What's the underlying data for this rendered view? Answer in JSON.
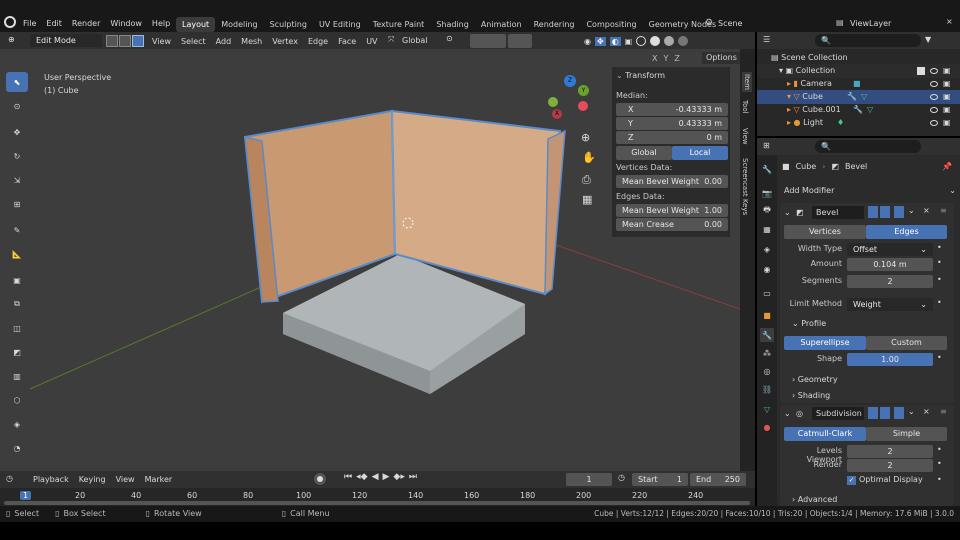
{
  "topbar": {
    "menus": [
      "File",
      "Edit",
      "Render",
      "Window",
      "Help"
    ],
    "workspaces": [
      "Layout",
      "Modeling",
      "Sculpting",
      "UV Editing",
      "Texture Paint",
      "Shading",
      "Animation",
      "Rendering",
      "Compositing",
      "Geometry Nodes"
    ],
    "active_workspace": "Layout",
    "scene": "Scene",
    "view_layer": "ViewLayer"
  },
  "viewport_header": {
    "mode": "Edit Mode",
    "menus": [
      "View",
      "Select",
      "Add",
      "Mesh",
      "Vertex",
      "Edge",
      "Face",
      "UV"
    ],
    "orientation": "Global",
    "options": "Options"
  },
  "viewport": {
    "perspective": "User Perspective",
    "object": "(1) Cube",
    "axes": [
      "X",
      "Y",
      "Z"
    ],
    "gizmo": {
      "x": "X",
      "y": "Y",
      "z": "Z"
    }
  },
  "npanel": {
    "section": "Transform",
    "median": "Median:",
    "x_label": "X",
    "x_value": "-0.43333 m",
    "y_label": "Y",
    "y_value": "0.43333 m",
    "z_label": "Z",
    "z_value": "0 m",
    "global": "Global",
    "local": "Local",
    "vertices_data": "Vertices Data:",
    "mean_bevel_weight": "Mean Bevel Weight",
    "v_bevel_value": "0.00",
    "edges_data": "Edges Data:",
    "e_bevel_value": "1.00",
    "mean_crease": "Mean Crease",
    "crease_value": "0.00",
    "tabs": [
      "Item",
      "Tool",
      "View",
      "Screencast Keys"
    ]
  },
  "outliner": {
    "scene_collection": "Scene Collection",
    "collection": "Collection",
    "items": [
      "Camera",
      "Cube",
      "Cube.001",
      "Light"
    ]
  },
  "properties": {
    "breadcrumb_object": "Cube",
    "breadcrumb_modifier": "Bevel",
    "add_modifier": "Add Modifier",
    "bevel": {
      "name": "Bevel",
      "vertices": "Vertices",
      "edges": "Edges",
      "width_type_label": "Width Type",
      "width_type": "Offset",
      "amount_label": "Amount",
      "amount": "0.104 m",
      "segments_label": "Segments",
      "segments": "2",
      "limit_method_label": "Limit Method",
      "limit_method": "Weight",
      "profile": "Profile",
      "superellipse": "Superellipse",
      "custom": "Custom",
      "shape_label": "Shape",
      "shape": "1.00",
      "geometry": "Geometry",
      "shading": "Shading"
    },
    "subdivision": {
      "name": "Subdivision",
      "catmull": "Catmull-Clark",
      "simple": "Simple",
      "levels_label": "Levels Viewport",
      "levels": "2",
      "render_label": "Render",
      "render": "2",
      "optimal": "Optimal Display",
      "advanced": "Advanced"
    }
  },
  "timeline": {
    "menus": [
      "Playback",
      "Keying",
      "View",
      "Marker"
    ],
    "current_frame": "1",
    "start_label": "Start",
    "start": "1",
    "end_label": "End",
    "end": "250",
    "ticks": [
      "1",
      "20",
      "40",
      "60",
      "80",
      "100",
      "120",
      "140",
      "160",
      "180",
      "200",
      "220",
      "240"
    ]
  },
  "statusbar": {
    "select": "Select",
    "box_select": "Box Select",
    "rotate": "Rotate View",
    "call_menu": "Call Menu",
    "stats": "Cube | Verts:12/12 | Edges:20/20 | Faces:10/10 | Tris:20 | Objects:1/4 | Memory: 17.6 MiB | 3.0.0"
  }
}
